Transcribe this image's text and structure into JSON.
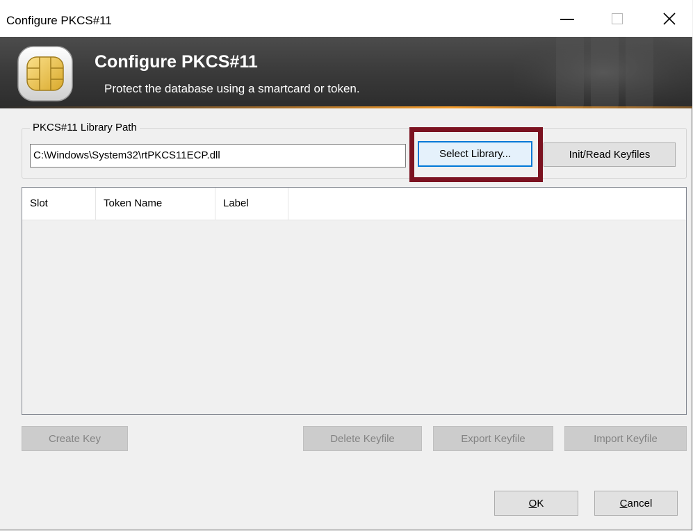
{
  "window": {
    "title": "Configure PKCS#11",
    "controls": {
      "minimize": "minimize-icon",
      "maximize": "maximize-icon",
      "close": "close-icon"
    }
  },
  "banner": {
    "title": "Configure PKCS#11",
    "subtitle": "Protect the database using a smartcard or token.",
    "icon": "smartcard-chip-icon"
  },
  "library_group": {
    "label": "PKCS#11 Library Path",
    "path_value": "C:\\Windows\\System32\\rtPKCS11ECP.dll",
    "select_library_label": "Select Library...",
    "init_read_label": "Init/Read Keyfiles"
  },
  "token_list": {
    "columns": [
      "Slot",
      "Token Name",
      "Label"
    ],
    "rows": []
  },
  "actions": {
    "create_key": "Create Key",
    "delete_keyfile": "Delete Keyfile",
    "export_keyfile": "Export Keyfile",
    "import_keyfile": "Import Keyfile"
  },
  "dialog_buttons": {
    "ok_mnemonic": "O",
    "ok_rest": "K",
    "cancel_mnemonic": "C",
    "cancel_rest": "ancel"
  },
  "colors": {
    "highlight": "#7b1220",
    "focus": "#0078d7",
    "banner_accent": "#f39c2c"
  }
}
